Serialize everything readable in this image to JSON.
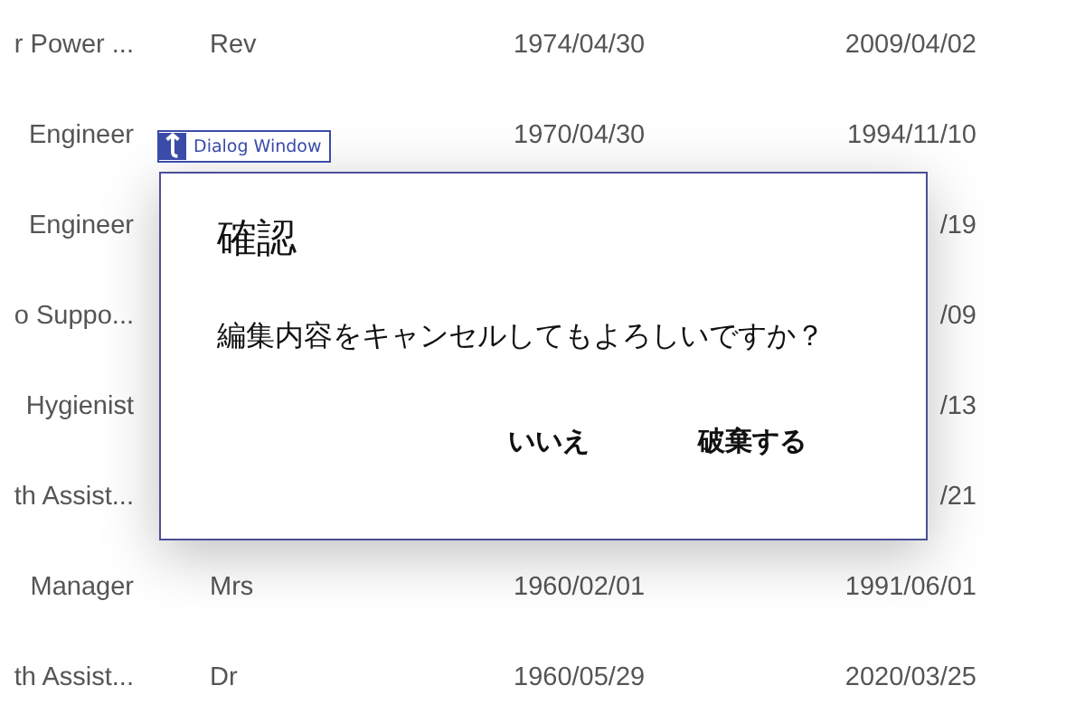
{
  "table": {
    "rows": [
      {
        "column_1": "r Power ...",
        "column_2": "Rev",
        "column_3": "1974/04/30",
        "column_4": "2009/04/02"
      },
      {
        "column_1": "Engineer",
        "column_3": "1970/04/30",
        "column_4": "1994/11/10"
      },
      {
        "column_1": "Engineer",
        "column_4": "/19"
      },
      {
        "column_1": "o Suppo...",
        "column_4": "/09"
      },
      {
        "column_1": "Hygienist",
        "column_4": "/13"
      },
      {
        "column_1": "th Assist...",
        "column_4": "/21"
      },
      {
        "column_1": "Manager",
        "column_2": "Mrs",
        "column_3": "1960/02/01",
        "column_4": "1991/06/01"
      },
      {
        "column_1": "th Assist...",
        "column_2": "Dr",
        "column_3": "1960/05/29",
        "column_4": "2020/03/25"
      }
    ]
  },
  "inspector_label": {
    "text": "Dialog Window"
  },
  "dialog": {
    "title": "確認",
    "message": "編集内容をキャンセルしてもよろしいですか？",
    "buttons": [
      "いいえ",
      "破棄する"
    ]
  }
}
